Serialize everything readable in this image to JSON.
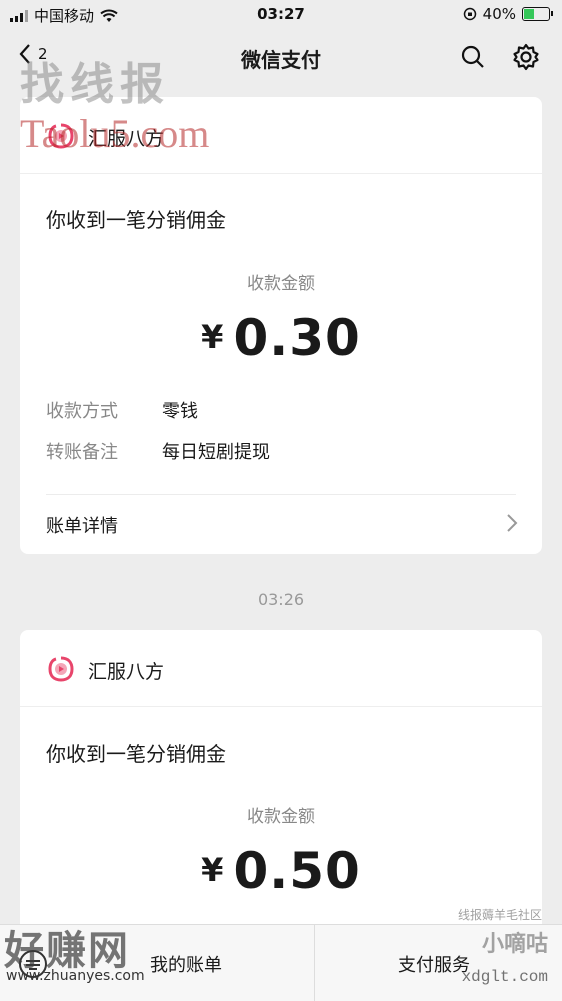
{
  "status_bar": {
    "carrier": "中国移动",
    "time": "03:27",
    "battery": "40%"
  },
  "nav": {
    "back_count": "2",
    "title": "微信支付"
  },
  "messages": [
    {
      "merchant": "汇服八方",
      "title": "你收到一笔分销佣金",
      "amount_label": "收款金额",
      "currency": "¥",
      "amount": "0.30",
      "rows": [
        {
          "key": "收款方式",
          "value": "零钱"
        },
        {
          "key": "转账备注",
          "value": "每日短剧提现"
        }
      ],
      "detail_label": "账单详情"
    },
    {
      "merchant": "汇服八方",
      "title": "你收到一笔分销佣金",
      "amount_label": "收款金额",
      "currency": "¥",
      "amount": "0.50"
    }
  ],
  "timestamp": "03:26",
  "bottom_bar": {
    "bills": "我的账单",
    "service": "支付服务"
  },
  "watermarks": {
    "top1": "找线报",
    "top2": "Taolu5.com",
    "bottom_left1": "好赚网",
    "bottom_left2": "www.zhuanyes.com",
    "bottom_right1": "线报薅羊毛社区",
    "bottom_right2": "小嘀咕",
    "bottom_right3": "xdglt.com"
  },
  "colors": {
    "background": "#ededed",
    "card": "#ffffff",
    "brand_logo": "#e8456b"
  }
}
